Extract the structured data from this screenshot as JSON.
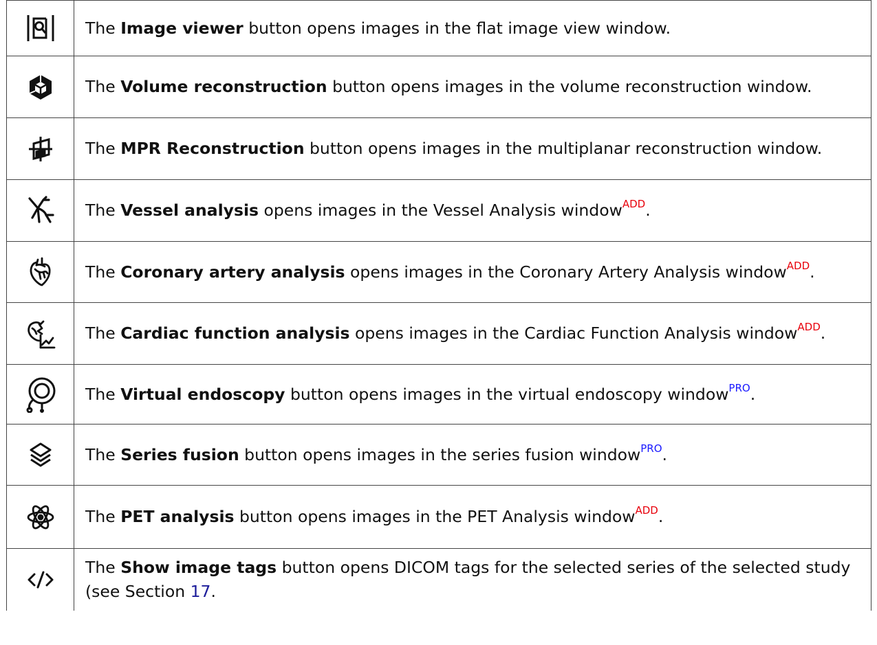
{
  "colors": {
    "add": "#e8000b",
    "pro": "#1a1aff",
    "link": "#1c1c9a",
    "border": "#444444",
    "icon": "#111111"
  },
  "rows": [
    {
      "icon": "image-viewer-icon",
      "pre": "The ",
      "bold": "Image viewer",
      "post": " button opens images in the flat image view window.",
      "badge": "",
      "tail": ""
    },
    {
      "icon": "volume-reconstruction-icon",
      "pre": "The ",
      "bold": "Volume reconstruction",
      "post": " button opens images in the volume reconstruction window.",
      "badge": "",
      "tail": ""
    },
    {
      "icon": "mpr-reconstruction-icon",
      "pre": "The ",
      "bold": "MPR Reconstruction",
      "post": " button opens images in the multiplanar reconstruction window.",
      "badge": "",
      "tail": ""
    },
    {
      "icon": "vessel-analysis-icon",
      "pre": "The ",
      "bold": "Vessel analysis",
      "post": " opens images in the Vessel Analysis window",
      "badge": "ADD",
      "tail": "."
    },
    {
      "icon": "coronary-artery-icon",
      "pre": "The ",
      "bold": "Coronary artery analysis",
      "post": " opens images in the Coronary Artery Analysis window",
      "badge": "ADD",
      "tail": "."
    },
    {
      "icon": "cardiac-function-icon",
      "pre": "The ",
      "bold": "Cardiac function analysis",
      "post": " opens images in the Cardiac Function Analysis window",
      "badge": "ADD",
      "tail": "."
    },
    {
      "icon": "virtual-endoscopy-icon",
      "pre": "The ",
      "bold": "Virtual endoscopy",
      "post": " button opens images in the virtual endoscopy window",
      "badge": "PRO",
      "tail": "."
    },
    {
      "icon": "series-fusion-icon",
      "pre": "The ",
      "bold": "Series fusion",
      "post": " button opens images in the series fusion window",
      "badge": "PRO",
      "tail": "."
    },
    {
      "icon": "pet-analysis-icon",
      "pre": "The ",
      "bold": "PET analysis",
      "post": " button opens images in the PET Analysis window",
      "badge": "ADD",
      "tail": "."
    },
    {
      "icon": "show-image-tags-icon",
      "pre": "The ",
      "bold": "Show image tags",
      "post": " button opens DICOM tags for the selected series of the selected study (see Section ",
      "link": "17",
      "tail": "."
    }
  ]
}
